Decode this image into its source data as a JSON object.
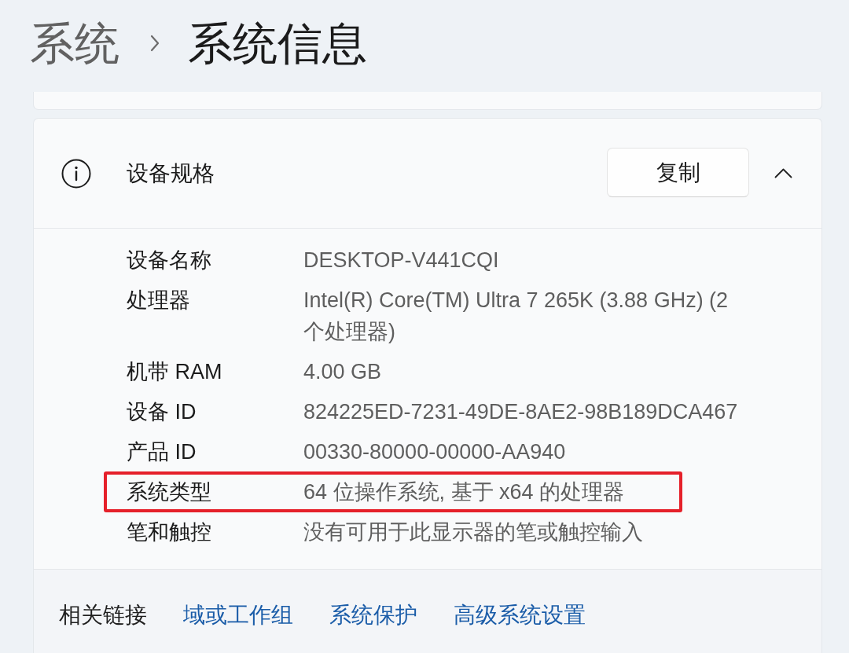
{
  "breadcrumb": [
    {
      "label": "系统",
      "current": false
    },
    {
      "label": "系统信息",
      "current": true
    }
  ],
  "device_specs": {
    "title": "设备规格",
    "copy_button": "复制",
    "expanded": true,
    "rows": [
      {
        "label": "设备名称",
        "value": "DESKTOP-V441CQI",
        "highlighted": false
      },
      {
        "label": "处理器",
        "value": "Intel(R) Core(TM) Ultra 7 265K (3.88 GHz) (2 个处理器)",
        "highlighted": false
      },
      {
        "label": "机带 RAM",
        "value": "4.00 GB",
        "highlighted": false
      },
      {
        "label": "设备 ID",
        "value": "824225ED-7231-49DE-8AE2-98B189DCA467",
        "highlighted": false
      },
      {
        "label": "产品 ID",
        "value": "00330-80000-00000-AA940",
        "highlighted": false
      },
      {
        "label": "系统类型",
        "value": "64 位操作系统, 基于 x64 的处理器",
        "highlighted": true
      },
      {
        "label": "笔和触控",
        "value": "没有可用于此显示器的笔或触控输入",
        "highlighted": false
      }
    ]
  },
  "related_links": {
    "label": "相关链接",
    "links": [
      "域或工作组",
      "系统保护",
      "高级系统设置"
    ]
  }
}
